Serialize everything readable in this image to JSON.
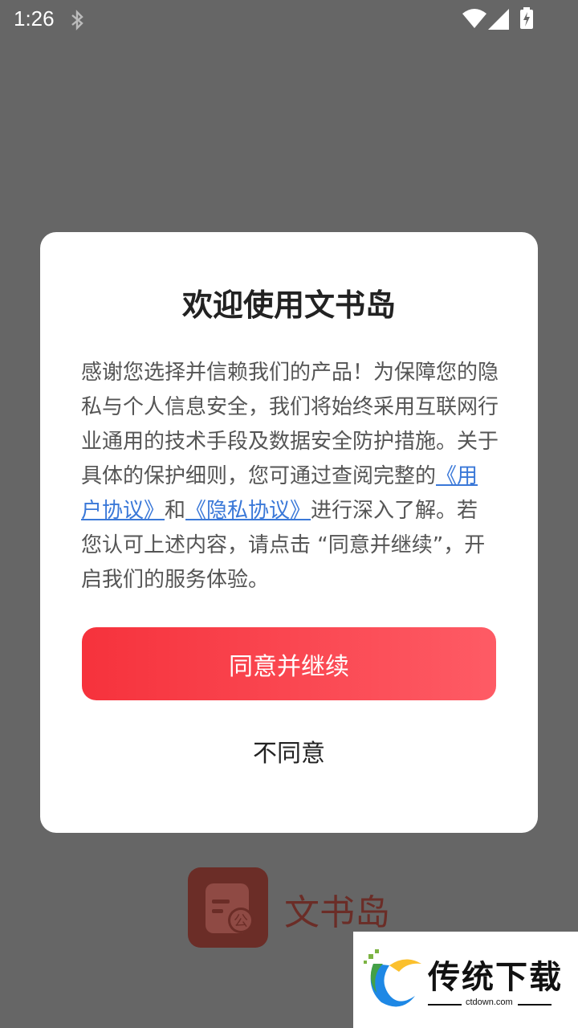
{
  "status_bar": {
    "time": "1:26"
  },
  "splash": {
    "app_name": "文书岛",
    "logo_badge": "公"
  },
  "dialog": {
    "title": "欢迎使用文书岛",
    "body": {
      "text_before": "感谢您选择并信赖我们的产品！为保障您的隐私与个人信息安全，我们将始终采用互联网行业通用的技术手段及数据安全防护措施。关于具体的保护细则，您可通过查阅完整的",
      "user_agreement_link": "《用户协议》",
      "conjunction": "和",
      "privacy_policy_link": "《隐私协议》",
      "text_after": "进行深入了解。若您认可上述内容，请点击 “同意并继续”，开启我们的服务体验。"
    },
    "agree_label": "同意并继续",
    "disagree_label": "不同意"
  },
  "watermark": {
    "brand": "传统下载",
    "url": "ctdown.com"
  },
  "colors": {
    "overlay": "#666666",
    "button_start": "#f6323c",
    "button_end": "#fe5b65",
    "link": "#3a78d8"
  }
}
